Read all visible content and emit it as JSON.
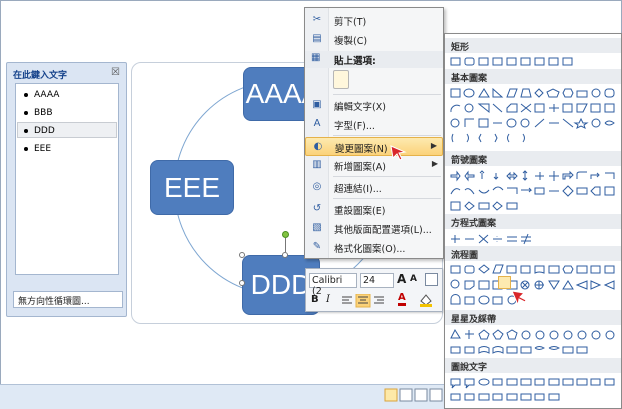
{
  "text_pane": {
    "title": "在此鍵入文字",
    "close": "☒",
    "items": [
      "AAAA",
      "BBB",
      "DDD",
      "EEE"
    ],
    "footer": "無方向性循環圖..."
  },
  "diagram": {
    "nodes": {
      "top": "AAAA",
      "left": "EEE",
      "bottom": "DDD"
    }
  },
  "context_menu": {
    "items": [
      {
        "icon": "✂",
        "label": "剪下(T)"
      },
      {
        "icon": "▤",
        "label": "複製(C)"
      },
      {
        "icon": "▦",
        "label": "貼上選項:"
      },
      {
        "icon": "▣",
        "label": "編輯文字(X)"
      },
      {
        "icon": "A",
        "label": "字型(F)..."
      },
      {
        "icon": "◐",
        "label": "變更圖案(N)"
      },
      {
        "icon": "▥",
        "label": "新增圖案(A)"
      },
      {
        "icon": "◎",
        "label": "超連結(I)..."
      },
      {
        "icon": "↺",
        "label": "重設圖案(E)"
      },
      {
        "icon": "▧",
        "label": "其他版面配置選項(L)..."
      },
      {
        "icon": "✎",
        "label": "格式化圖案(O)..."
      }
    ]
  },
  "mini_toolbar": {
    "font": "Calibri (2",
    "size": "24",
    "grow": "A",
    "shrink": "A",
    "bold": "B",
    "italic": "I",
    "font_color": "A"
  },
  "gallery": {
    "categories": [
      "矩形",
      "基本圖案",
      "箭號圖案",
      "方程式圖案",
      "流程圖",
      "星星及綵帶",
      "圖說文字"
    ]
  },
  "colors": {
    "node_fill": "#4f7dbe",
    "highlight": "#fbd27a",
    "cursor_arrow": "#d9262a"
  }
}
